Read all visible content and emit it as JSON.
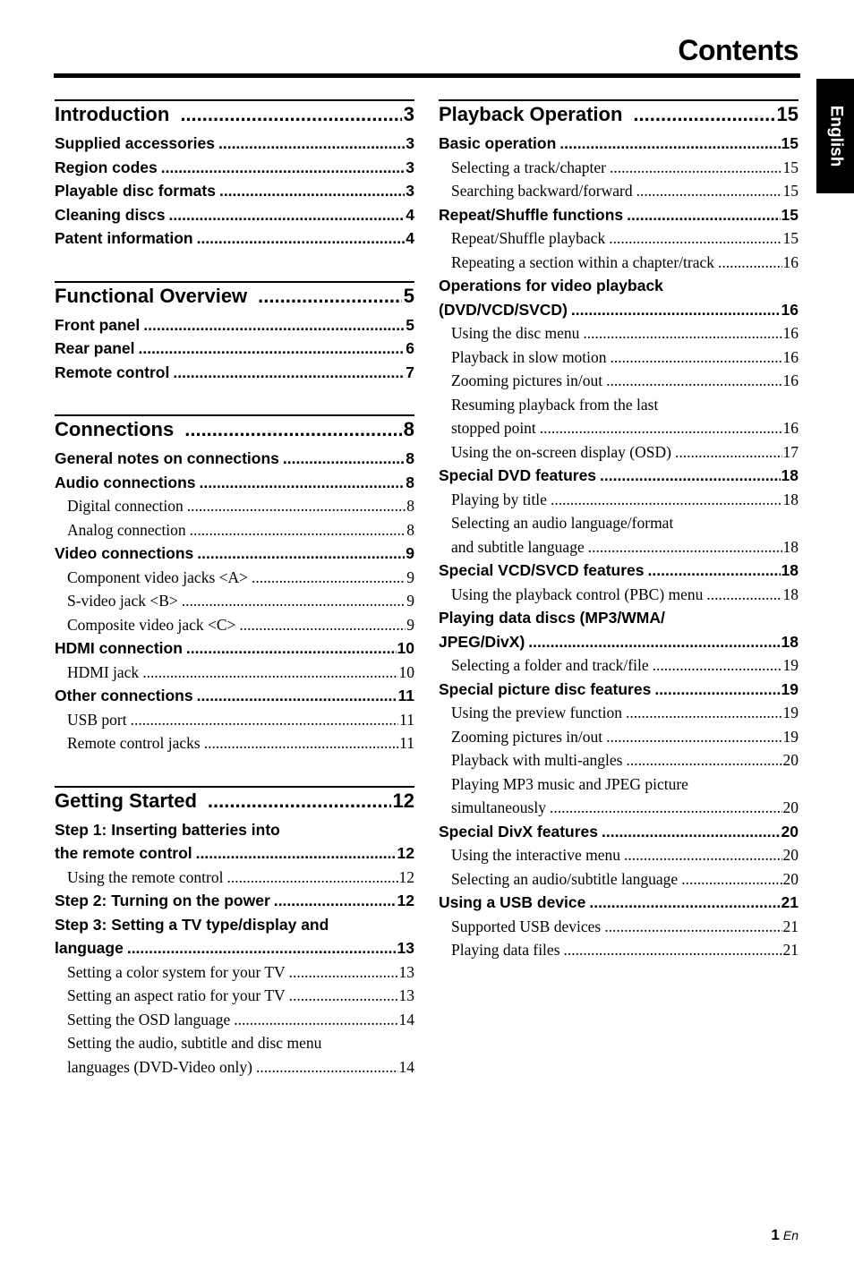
{
  "page_title": "Contents",
  "language_tab": "English",
  "footer": {
    "page_number": "1",
    "language_code": "En"
  },
  "left_column": [
    {
      "title": "Introduction",
      "page": "3",
      "entries": [
        {
          "level": 1,
          "text": "Supplied accessories",
          "page": "3"
        },
        {
          "level": 1,
          "text": "Region codes",
          "page": "3"
        },
        {
          "level": 1,
          "text": "Playable disc formats",
          "page": "3"
        },
        {
          "level": 1,
          "text": "Cleaning discs",
          "page": "4"
        },
        {
          "level": 1,
          "text": "Patent information",
          "page": "4"
        }
      ]
    },
    {
      "title": "Functional Overview",
      "page": "5",
      "entries": [
        {
          "level": 1,
          "text": "Front panel",
          "page": "5"
        },
        {
          "level": 1,
          "text": "Rear panel",
          "page": "6"
        },
        {
          "level": 1,
          "text": "Remote control",
          "page": "7"
        }
      ]
    },
    {
      "title": "Connections",
      "page": "8",
      "entries": [
        {
          "level": 1,
          "text": "General notes on connections",
          "page": "8"
        },
        {
          "level": 1,
          "text": "Audio connections",
          "page": "8"
        },
        {
          "level": 2,
          "text": "Digital connection",
          "page": "8"
        },
        {
          "level": 2,
          "text": "Analog connection",
          "page": "8"
        },
        {
          "level": 1,
          "text": "Video connections",
          "page": "9"
        },
        {
          "level": 2,
          "text": "Component video jacks <A>",
          "page": "9"
        },
        {
          "level": 2,
          "text": "S-video jack <B>",
          "page": "9"
        },
        {
          "level": 2,
          "text": "Composite video jack <C>",
          "page": "9"
        },
        {
          "level": 1,
          "text": "HDMI connection",
          "page": "10"
        },
        {
          "level": 2,
          "text": "HDMI jack",
          "page": "10"
        },
        {
          "level": 1,
          "text": "Other connections",
          "page": "11"
        },
        {
          "level": 2,
          "text": "USB port",
          "page": "11"
        },
        {
          "level": 2,
          "text": "Remote control jacks",
          "page": "11"
        }
      ]
    },
    {
      "title": "Getting Started",
      "page": "12",
      "entries": [
        {
          "level": 1,
          "text_line1": "Step 1: Inserting batteries into",
          "text": "the remote control",
          "page": "12"
        },
        {
          "level": 2,
          "text": "Using the remote control",
          "page": "12"
        },
        {
          "level": 1,
          "text": "Step 2: Turning on the power",
          "page": "12"
        },
        {
          "level": 1,
          "text_line1": "Step 3: Setting a TV type/display and",
          "text": "language",
          "page": "13"
        },
        {
          "level": 2,
          "text": "Setting a color system for your TV",
          "page": "13"
        },
        {
          "level": 2,
          "text": "Setting an aspect ratio for your TV",
          "page": "13"
        },
        {
          "level": 2,
          "text": "Setting the OSD language",
          "page": "14"
        },
        {
          "level": 2,
          "text_line1": "Setting the audio, subtitle and disc menu",
          "text": "languages (DVD-Video only)",
          "page": "14"
        }
      ]
    }
  ],
  "right_column": [
    {
      "title": "Playback Operation",
      "page": "15",
      "entries": [
        {
          "level": 1,
          "text": "Basic operation",
          "page": "15"
        },
        {
          "level": 2,
          "text": "Selecting a track/chapter",
          "page": "15"
        },
        {
          "level": 2,
          "text": "Searching backward/forward",
          "page": "15"
        },
        {
          "level": 1,
          "text": "Repeat/Shuffle functions",
          "page": "15"
        },
        {
          "level": 2,
          "text": "Repeat/Shuffle playback",
          "page": "15"
        },
        {
          "level": 2,
          "text": "Repeating a section within a chapter/track",
          "page": "16"
        },
        {
          "level": 1,
          "text_line1": "Operations for video playback",
          "text": "(DVD/VCD/SVCD)",
          "page": "16"
        },
        {
          "level": 2,
          "text": "Using the disc menu",
          "page": "16"
        },
        {
          "level": 2,
          "text": "Playback in slow motion",
          "page": "16"
        },
        {
          "level": 2,
          "text": "Zooming pictures in/out",
          "page": "16"
        },
        {
          "level": 2,
          "text_line1": "Resuming playback from the last",
          "text": "stopped point",
          "page": "16"
        },
        {
          "level": 2,
          "text": "Using the on-screen display (OSD)",
          "page": "17"
        },
        {
          "level": 1,
          "text": "Special DVD features",
          "page": "18"
        },
        {
          "level": 2,
          "text": "Playing by title",
          "page": "18"
        },
        {
          "level": 2,
          "text_line1": "Selecting an audio language/format",
          "text": "and subtitle language",
          "page": "18"
        },
        {
          "level": 1,
          "text": "Special VCD/SVCD features",
          "page": "18"
        },
        {
          "level": 2,
          "text": "Using the playback control (PBC) menu",
          "page": "18"
        },
        {
          "level": 1,
          "text_line1": "Playing data discs (MP3/WMA/",
          "text": "JPEG/DivX)",
          "page": "18"
        },
        {
          "level": 2,
          "text": "Selecting a folder and track/file",
          "page": "19"
        },
        {
          "level": 1,
          "text": "Special picture disc features",
          "page": "19"
        },
        {
          "level": 2,
          "text": "Using the preview function",
          "page": "19"
        },
        {
          "level": 2,
          "text": "Zooming pictures in/out",
          "page": "19"
        },
        {
          "level": 2,
          "text": "Playback with multi-angles",
          "page": "20"
        },
        {
          "level": 2,
          "text_line1": "Playing MP3 music and JPEG picture",
          "text": "simultaneously",
          "page": "20"
        },
        {
          "level": 1,
          "text": "Special DivX features",
          "page": "20"
        },
        {
          "level": 2,
          "text": "Using the interactive menu",
          "page": "20"
        },
        {
          "level": 2,
          "text": "Selecting an audio/subtitle language",
          "page": "20"
        },
        {
          "level": 1,
          "text": "Using a USB device",
          "page": "21"
        },
        {
          "level": 2,
          "text": "Supported USB devices",
          "page": "21"
        },
        {
          "level": 2,
          "text": "Playing data files",
          "page": "21"
        }
      ]
    }
  ]
}
